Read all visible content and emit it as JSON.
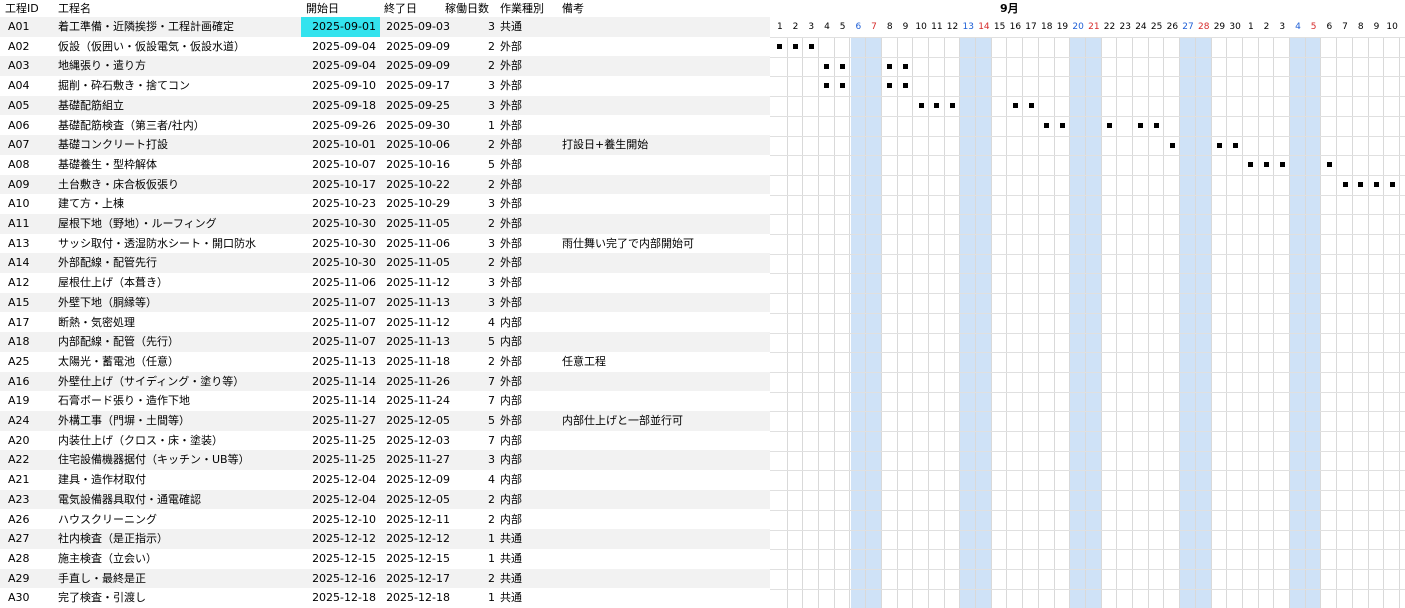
{
  "headers": {
    "id": "工程ID",
    "name": "工程名",
    "start": "開始日",
    "end": "終了日",
    "days": "稼働日数",
    "type": "作業種別",
    "note": "備考"
  },
  "gantt": {
    "month_label": "9月",
    "days": [
      "1",
      "2",
      "3",
      "4",
      "5",
      "6",
      "7",
      "8",
      "9",
      "10",
      "11",
      "12",
      "13",
      "14",
      "15",
      "16",
      "17",
      "18",
      "19",
      "20",
      "21",
      "22",
      "23",
      "24",
      "25",
      "26",
      "27",
      "28",
      "29",
      "30",
      "1",
      "2",
      "3",
      "4",
      "5",
      "6",
      "7",
      "8",
      "9",
      "10"
    ],
    "saturday_indices": [
      5,
      12,
      19,
      26,
      33
    ],
    "sunday_indices": [
      6,
      13,
      20,
      27,
      34
    ],
    "marks": [
      {
        "row": 1,
        "days": [
          0,
          1,
          2
        ]
      },
      {
        "row": 2,
        "days": [
          3,
          4,
          7,
          8
        ]
      },
      {
        "row": 3,
        "days": [
          3,
          4,
          7,
          8
        ]
      },
      {
        "row": 4,
        "days": [
          9,
          10,
          11,
          15,
          16
        ]
      },
      {
        "row": 5,
        "days": [
          17,
          18,
          21,
          23,
          24
        ]
      },
      {
        "row": 6,
        "days": [
          25,
          28,
          29
        ]
      },
      {
        "row": 7,
        "days": [
          30,
          31,
          32,
          35
        ]
      },
      {
        "row": 8,
        "days": [
          36,
          37,
          38,
          39
        ]
      }
    ]
  },
  "selected_cell": {
    "row": 0,
    "column": "start"
  },
  "rows": [
    {
      "id": "A01",
      "name": "着工準備・近隣挨拶・工程計画確定",
      "start": "2025-09-01",
      "end": "2025-09-03",
      "days": "3",
      "type": "共通",
      "note": ""
    },
    {
      "id": "A02",
      "name": "仮設（仮囲い・仮設電気・仮設水道）",
      "start": "2025-09-04",
      "end": "2025-09-09",
      "days": "2",
      "type": "外部",
      "note": ""
    },
    {
      "id": "A03",
      "name": "地縄張り・遣り方",
      "start": "2025-09-04",
      "end": "2025-09-09",
      "days": "2",
      "type": "外部",
      "note": ""
    },
    {
      "id": "A04",
      "name": "掘削・砕石敷き・捨てコン",
      "start": "2025-09-10",
      "end": "2025-09-17",
      "days": "3",
      "type": "外部",
      "note": ""
    },
    {
      "id": "A05",
      "name": "基礎配筋組立",
      "start": "2025-09-18",
      "end": "2025-09-25",
      "days": "3",
      "type": "外部",
      "note": ""
    },
    {
      "id": "A06",
      "name": "基礎配筋検査（第三者/社内）",
      "start": "2025-09-26",
      "end": "2025-09-30",
      "days": "1",
      "type": "外部",
      "note": ""
    },
    {
      "id": "A07",
      "name": "基礎コンクリート打設",
      "start": "2025-10-01",
      "end": "2025-10-06",
      "days": "2",
      "type": "外部",
      "note": "打設日+養生開始"
    },
    {
      "id": "A08",
      "name": "基礎養生・型枠解体",
      "start": "2025-10-07",
      "end": "2025-10-16",
      "days": "5",
      "type": "外部",
      "note": ""
    },
    {
      "id": "A09",
      "name": "土台敷き・床合板仮張り",
      "start": "2025-10-17",
      "end": "2025-10-22",
      "days": "2",
      "type": "外部",
      "note": ""
    },
    {
      "id": "A10",
      "name": "建て方・上棟",
      "start": "2025-10-23",
      "end": "2025-10-29",
      "days": "3",
      "type": "外部",
      "note": ""
    },
    {
      "id": "A11",
      "name": "屋根下地（野地）・ルーフィング",
      "start": "2025-10-30",
      "end": "2025-11-05",
      "days": "2",
      "type": "外部",
      "note": ""
    },
    {
      "id": "A13",
      "name": "サッシ取付・透湿防水シート・開口防水",
      "start": "2025-10-30",
      "end": "2025-11-06",
      "days": "3",
      "type": "外部",
      "note": "雨仕舞い完了で内部開始可"
    },
    {
      "id": "A14",
      "name": "外部配線・配管先行",
      "start": "2025-10-30",
      "end": "2025-11-05",
      "days": "2",
      "type": "外部",
      "note": ""
    },
    {
      "id": "A12",
      "name": "屋根仕上げ（本葺き）",
      "start": "2025-11-06",
      "end": "2025-11-12",
      "days": "3",
      "type": "外部",
      "note": ""
    },
    {
      "id": "A15",
      "name": "外壁下地（胴縁等）",
      "start": "2025-11-07",
      "end": "2025-11-13",
      "days": "3",
      "type": "外部",
      "note": ""
    },
    {
      "id": "A17",
      "name": "断熱・気密処理",
      "start": "2025-11-07",
      "end": "2025-11-12",
      "days": "4",
      "type": "内部",
      "note": ""
    },
    {
      "id": "A18",
      "name": "内部配線・配管（先行）",
      "start": "2025-11-07",
      "end": "2025-11-13",
      "days": "5",
      "type": "内部",
      "note": ""
    },
    {
      "id": "A25",
      "name": "太陽光・蓄電池（任意）",
      "start": "2025-11-13",
      "end": "2025-11-18",
      "days": "2",
      "type": "外部",
      "note": "任意工程"
    },
    {
      "id": "A16",
      "name": "外壁仕上げ（サイディング・塗り等）",
      "start": "2025-11-14",
      "end": "2025-11-26",
      "days": "7",
      "type": "外部",
      "note": ""
    },
    {
      "id": "A19",
      "name": "石膏ボード張り・造作下地",
      "start": "2025-11-14",
      "end": "2025-11-24",
      "days": "7",
      "type": "内部",
      "note": ""
    },
    {
      "id": "A24",
      "name": "外構工事（門塀・土間等）",
      "start": "2025-11-27",
      "end": "2025-12-05",
      "days": "5",
      "type": "外部",
      "note": "内部仕上げと一部並行可"
    },
    {
      "id": "A20",
      "name": "内装仕上げ（クロス・床・塗装）",
      "start": "2025-11-25",
      "end": "2025-12-03",
      "days": "7",
      "type": "内部",
      "note": ""
    },
    {
      "id": "A22",
      "name": "住宅設備機器据付（キッチン・UB等）",
      "start": "2025-11-25",
      "end": "2025-11-27",
      "days": "3",
      "type": "内部",
      "note": ""
    },
    {
      "id": "A21",
      "name": "建具・造作材取付",
      "start": "2025-12-04",
      "end": "2025-12-09",
      "days": "4",
      "type": "内部",
      "note": ""
    },
    {
      "id": "A23",
      "name": "電気設備器具取付・通電確認",
      "start": "2025-12-04",
      "end": "2025-12-05",
      "days": "2",
      "type": "内部",
      "note": ""
    },
    {
      "id": "A26",
      "name": "ハウスクリーニング",
      "start": "2025-12-10",
      "end": "2025-12-11",
      "days": "2",
      "type": "内部",
      "note": ""
    },
    {
      "id": "A27",
      "name": "社内検査（是正指示）",
      "start": "2025-12-12",
      "end": "2025-12-12",
      "days": "1",
      "type": "共通",
      "note": ""
    },
    {
      "id": "A28",
      "name": "施主検査（立会い）",
      "start": "2025-12-15",
      "end": "2025-12-15",
      "days": "1",
      "type": "共通",
      "note": ""
    },
    {
      "id": "A29",
      "name": "手直し・最終是正",
      "start": "2025-12-16",
      "end": "2025-12-17",
      "days": "2",
      "type": "共通",
      "note": ""
    },
    {
      "id": "A30",
      "name": "完了検査・引渡し",
      "start": "2025-12-18",
      "end": "2025-12-18",
      "days": "1",
      "type": "共通",
      "note": ""
    }
  ]
}
